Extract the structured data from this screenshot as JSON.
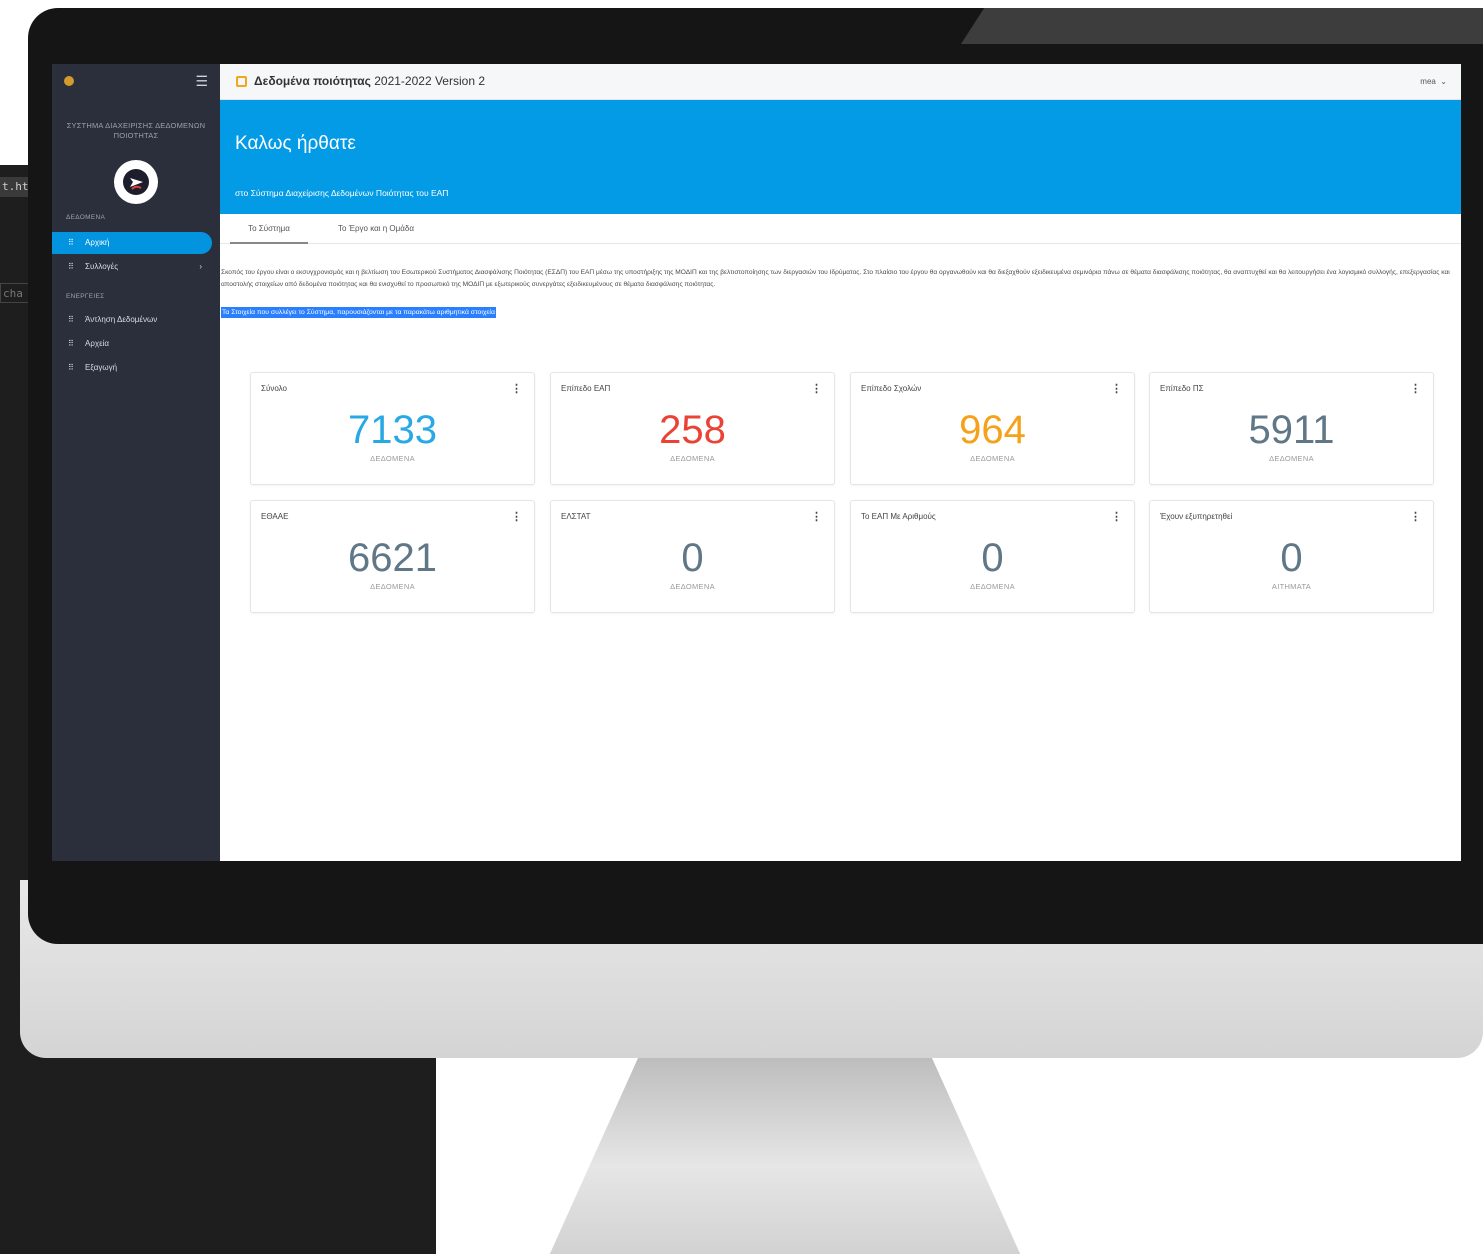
{
  "background": {
    "code_fragment_1": "t.ht",
    "code_fragment_2": "cha"
  },
  "sidebar": {
    "system_title": "ΣΥΣΤΗΜΑ ΔΙΑΧΕΙΡΙΣΗΣ ΔΕΔΟΜΕΝΩΝ ΠΟΙΟΤΗΤΑΣ",
    "sections": {
      "data": "ΔΕΔΟΜΕΝΑ",
      "actions": "ΕΝΕΡΓΕΙΕΣ"
    },
    "items": [
      {
        "label": "Αρχική",
        "active": true
      },
      {
        "label": "Συλλογές",
        "has_submenu": true
      },
      {
        "label": "Άντληση Δεδομένων"
      },
      {
        "label": "Αρχεία"
      },
      {
        "label": "Εξαγωγή"
      }
    ],
    "colors": {
      "background": "#2b2f3c",
      "active": "#0394e0"
    }
  },
  "topbar": {
    "title_bold": "Δεδομένα ποιότητας",
    "title_rest": " 2021-2022 Version 2",
    "user": "mea",
    "user_chevron": "⌄"
  },
  "hero": {
    "title": "Καλως ήρθατε",
    "subtitle": "στο Σύστημα Διαχείρισης Δεδομένων Ποιότητας του ΕΑΠ",
    "color": "#039be5"
  },
  "tabs": [
    {
      "label": "Το Σύστημα",
      "active": true
    },
    {
      "label": "Το Έργο και η Ομάδα"
    }
  ],
  "intro": {
    "paragraph": "Σκοπός του έργου είναι ο εκσυγχρονισμός και η βελτίωση του Εσωτερικού Συστήματος Διασφάλισης Ποιότητας (ΕΣΔΠ) του ΕΑΠ μέσω της υποστήριξης της ΜΟΔΙΠ και της βελτιστοποίησης των διεργασιών του Ιδρύματος. Στο πλαίσιο του έργου θα οργανωθούν και θα διεξαχθούν εξειδικευμένα σεμινάρια πάνω σε θέματα διασφάλισης ποιότητας, θα αναπτυχθεί και θα λειτουργήσει ένα λογισμικό συλλογής, επεξεργασίας και αποστολής στοιχείων από δεδομένα ποιότητας και θα ενισχυθεί το προσωπικό της ΜΟΔΙΠ με εξωτερικούς συνεργάτες εξειδικευμένους σε θέματα διασφάλισης ποιότητας.",
    "highlight": "Τα Στοιχεία που συλλέγει το Σύστημα, παρουσιάζονται με τα παρακάτω αριθμητικά στοιχεία"
  },
  "stats": [
    {
      "label": "Σύνολο",
      "value": "7133",
      "unit": "ΔΕΔΟΜΕΝΑ",
      "color": "#29a8e6"
    },
    {
      "label": "Επίπεδο ΕΑΠ",
      "value": "258",
      "unit": "ΔΕΔΟΜΕΝΑ",
      "color": "#ea4335"
    },
    {
      "label": "Επίπεδο Σχολών",
      "value": "964",
      "unit": "ΔΕΔΟΜΕΝΑ",
      "color": "#f5a21b"
    },
    {
      "label": "Επίπεδο ΠΣ",
      "value": "5911",
      "unit": "ΔΕΔΟΜΕΝΑ",
      "color": "#5f7786"
    },
    {
      "label": "ΕΘΑΑΕ",
      "value": "6621",
      "unit": "ΔΕΔΟΜΕΝΑ",
      "color": "#5f7786"
    },
    {
      "label": "ΕΛΣΤΑΤ",
      "value": "0",
      "unit": "ΔΕΔΟΜΕΝΑ",
      "color": "#5f7786"
    },
    {
      "label": "Το ΕΑΠ Με Αριθμούς",
      "value": "0",
      "unit": "ΔΕΔΟΜΕΝΑ",
      "color": "#5f7786"
    },
    {
      "label": "Έχουν εξυπηρετηθεί",
      "value": "0",
      "unit": "ΑΙΤΗΜΑΤΑ",
      "color": "#5f7786"
    }
  ],
  "icons": {
    "menu": "hamburger-icon",
    "calendar": "calendar-icon",
    "grid": "grid-icon",
    "more": "more-vertical-icon",
    "chevron": "chevron-right-icon"
  }
}
